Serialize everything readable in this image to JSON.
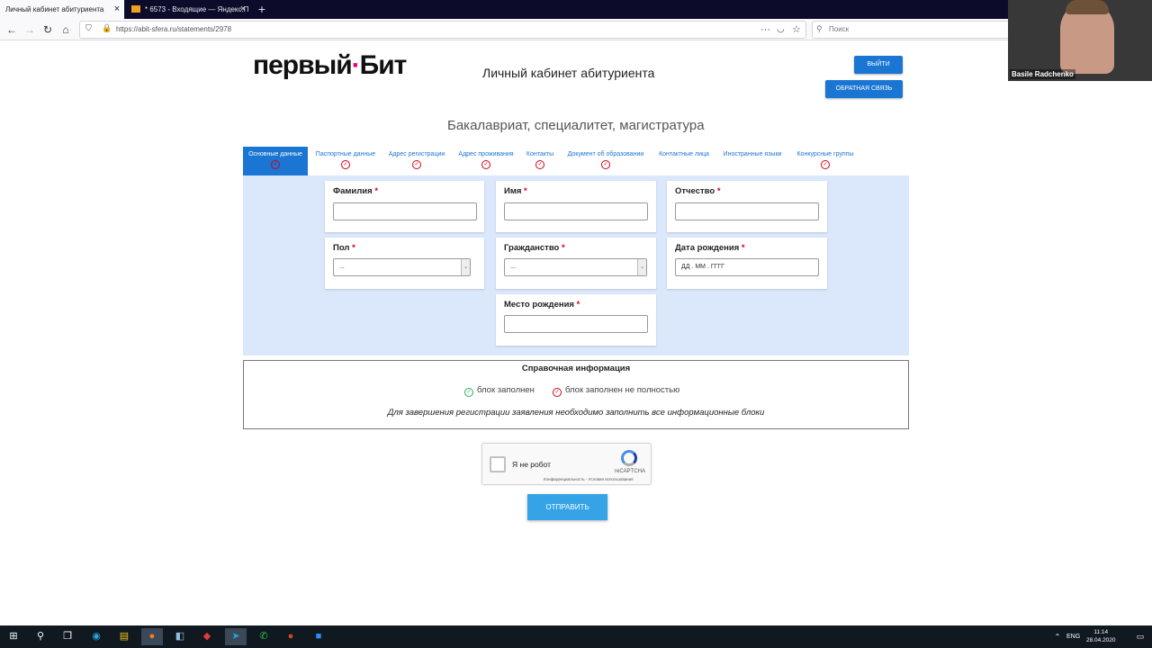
{
  "browser": {
    "tabs": [
      {
        "title": "Личный кабинет абитуриента",
        "active": true
      },
      {
        "title": "* 6573 - Входящие — Яндекс.П",
        "active": false
      }
    ],
    "new_tab_icon": "plus-icon",
    "url": "https://abit-sfera.ru/statements/2978",
    "search_placeholder": "Поиск"
  },
  "video_overlay": {
    "name": "Basile Radchenko"
  },
  "header": {
    "logo_left": "первый",
    "logo_dot": "·",
    "logo_right": "Бит",
    "title": "Личный кабинет абитуриента",
    "logout_label": "ВЫЙТИ",
    "feedback_label": "ОБРАТНАЯ СВЯЗЬ"
  },
  "program_title": "Бакалавриат, специалитет, магистратура",
  "form_tabs": [
    {
      "label": "Основные данные",
      "selected": true
    },
    {
      "label": "Паспортные данные",
      "selected": false
    },
    {
      "label": "Адрес регистрации",
      "selected": false
    },
    {
      "label": "Адрес проживания",
      "selected": false
    },
    {
      "label": "Контакты",
      "selected": false
    },
    {
      "label": "Документ об образовании",
      "selected": false
    },
    {
      "label": "Контактные лица",
      "selected": false
    },
    {
      "label": "Иностранные языки",
      "selected": false
    },
    {
      "label": "Конкурсные группы",
      "selected": false
    }
  ],
  "fields": {
    "surname": {
      "label": "Фамилия",
      "value": ""
    },
    "name": {
      "label": "Имя",
      "value": ""
    },
    "patronymic": {
      "label": "Отчество",
      "value": ""
    },
    "gender": {
      "label": "Пол",
      "value": "..."
    },
    "citizenship": {
      "label": "Гражданство",
      "value": "..."
    },
    "birthdate": {
      "label": "Дата рождения",
      "placeholder": "ДД . ММ . ГГГГ"
    },
    "birthplace": {
      "label": "Место рождения",
      "value": ""
    },
    "required_mark": "*"
  },
  "info": {
    "title": "Справочная информация",
    "legend_complete": "блок заполнен",
    "legend_incomplete": "блок заполнен не полностью",
    "note": "Для завершения регистрации заявления необходимо заполнить все информационные блоки"
  },
  "captcha": {
    "label": "Я не робот",
    "brand": "reCAPTCHA",
    "links": "Конфиденциальность - Условия использования"
  },
  "submit_label": "ОТПРАВИТЬ",
  "taskbar": {
    "lang": "ENG",
    "time": "11:14",
    "date": "28.04.2020"
  },
  "colors": {
    "accent": "#1a76d2",
    "error": "#d0021b",
    "success": "#27ae60",
    "form_bg": "#dbe7fb"
  }
}
